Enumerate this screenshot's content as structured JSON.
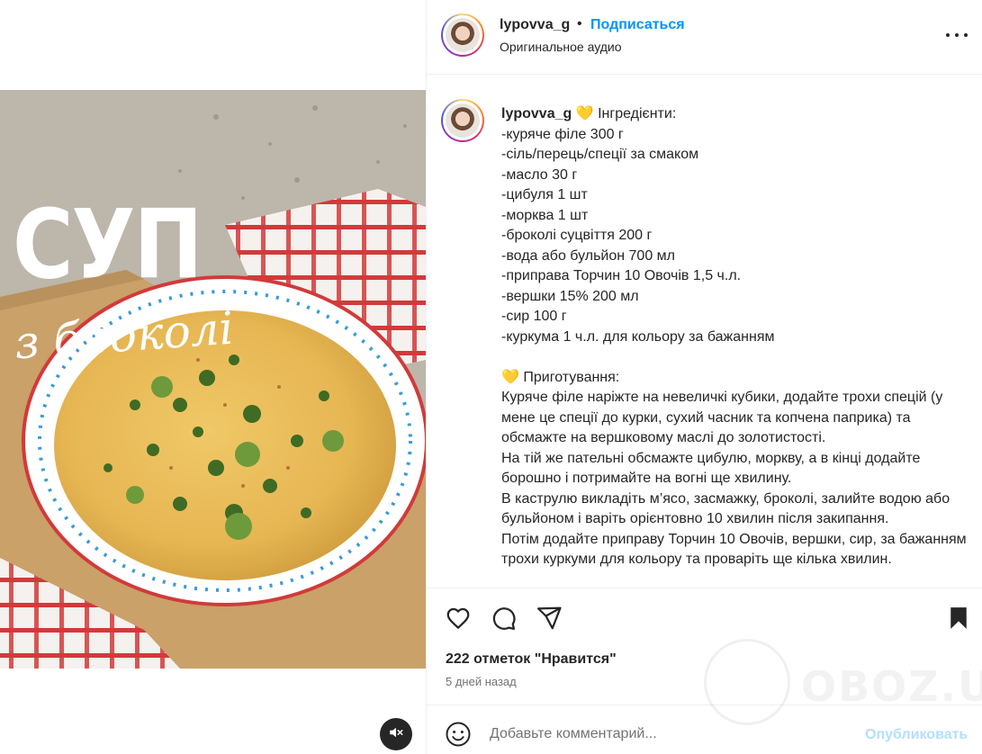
{
  "post": {
    "image_title": "СУП",
    "image_subtitle": "з броколі",
    "mute_icon": "speaker-muted-icon"
  },
  "header": {
    "username": "lypovva_g",
    "separator": "•",
    "follow_label": "Подписаться",
    "audio_label": "Оригинальное аудио",
    "more_icon": "more-horizontal-icon"
  },
  "caption": {
    "username": "lypovva_g",
    "heart_emoji": "💛",
    "ingredients_title": "Інгредієнти:",
    "ingredients": [
      "-куряче філе 300 г",
      "-сіль/перець/спеції за смаком",
      "-масло 30 г",
      "-цибуля 1 шт",
      "-морква 1 шт",
      "-броколі суцвіття 200 г",
      "-вода або бульйон 700 мл",
      "-приправа Торчин 10 Овочів 1,5 ч.л.",
      "-вершки 15% 200 мл",
      "-сир 100 г",
      "-куркума 1 ч.л. для кольору за бажанням"
    ],
    "preparation_title": "Приготування:",
    "preparation": [
      "Куряче філе наріжте на невеличкі кубики, додайте трохи спецій (у мене це спеції до курки, сухий часник та копчена паприка) та обсмажте на вершковому маслі до золотистості.",
      "На тій же пательні обсмажте цибулю, моркву, а в кінці додайте борошно і потримайте на вогні ще хвилину.",
      "В каструлю викладіть м’ясо, засмажку, броколі, залийте водою або бульйоном і варіть орієнтовно 10 хвилин після закипання.",
      "Потім додайте приправу Торчин 10 Овочів, вершки, сир, за бажанням трохи куркуми для кольору та проваріть ще кілька хвилин."
    ]
  },
  "actions": {
    "like_icon": "heart-icon",
    "comment_icon": "comment-icon",
    "share_icon": "share-icon",
    "save_icon": "bookmark-icon",
    "likes_text": "222 отметок \"Нравится\"",
    "time_text": "5 дней назад"
  },
  "comment": {
    "emoji_icon": "emoji-icon",
    "placeholder": "Добавьте комментарий...",
    "publish_label": "Опубликовать"
  },
  "watermark": {
    "text": "OBOZ.UA"
  },
  "colors": {
    "accent": "#0095f6",
    "publish_disabled": "#b2dffc",
    "text": "#262626",
    "muted": "#737373",
    "border": "#efefef"
  }
}
